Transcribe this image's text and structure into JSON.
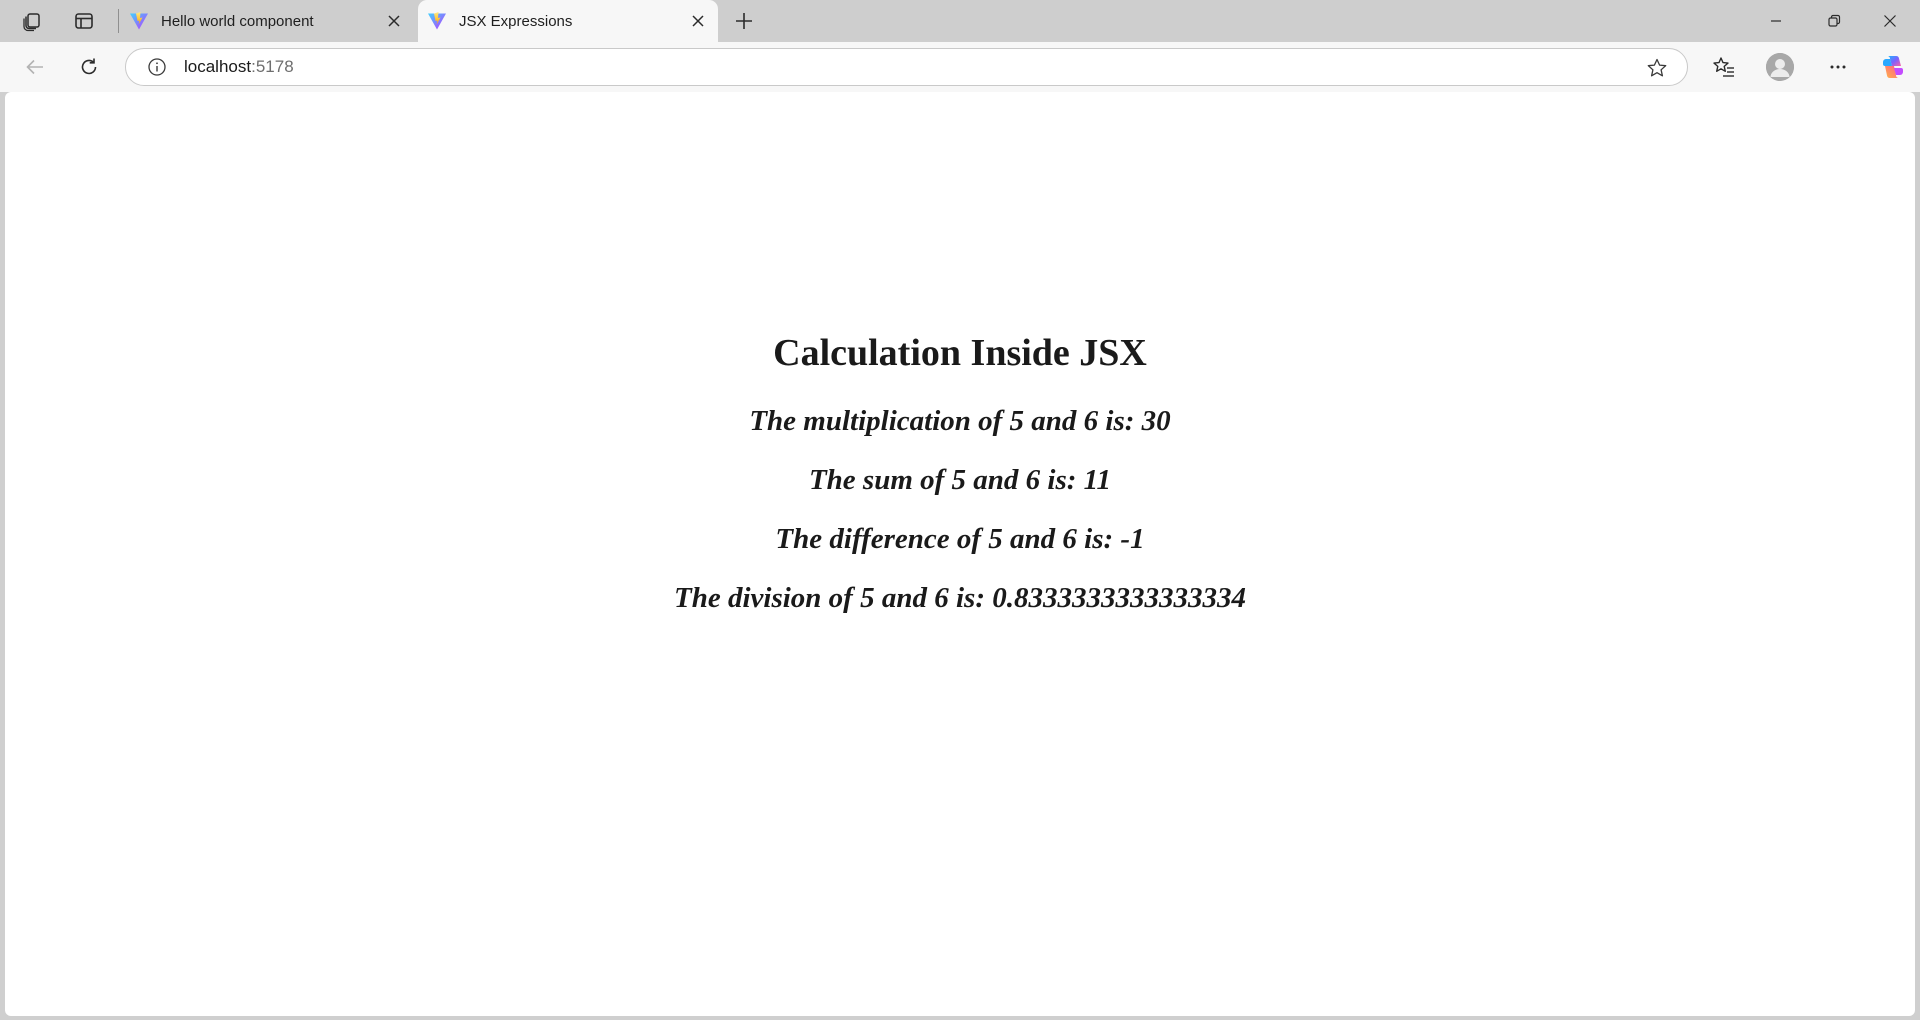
{
  "browser": {
    "tabs": [
      {
        "title": "Hello world component",
        "active": false,
        "favicon": "vite-logo-icon"
      },
      {
        "title": "JSX Expressions",
        "active": true,
        "favicon": "vite-logo-icon"
      }
    ],
    "address": {
      "host": "localhost",
      "port": ":5178"
    },
    "icons": {
      "workspaces": "workspaces-icon",
      "tab_actions": "tab-actions-icon",
      "new_tab": "plus-icon",
      "minimize": "minimize-icon",
      "restore": "restore-icon",
      "close": "close-icon",
      "back": "back-arrow-icon",
      "refresh": "refresh-icon",
      "site_info": "info-icon",
      "favorite": "star-icon",
      "favorites": "favorites-list-icon",
      "profile": "avatar",
      "more": "more-icon",
      "copilot": "copilot-icon"
    }
  },
  "page": {
    "heading": "Calculation Inside JSX",
    "lines": [
      "The multiplication of 5 and 6 is: 30",
      "The sum of 5 and 6 is: 11",
      "The difference of 5 and 6 is: -1",
      "The division of 5 and 6 is: 0.8333333333333334"
    ]
  }
}
